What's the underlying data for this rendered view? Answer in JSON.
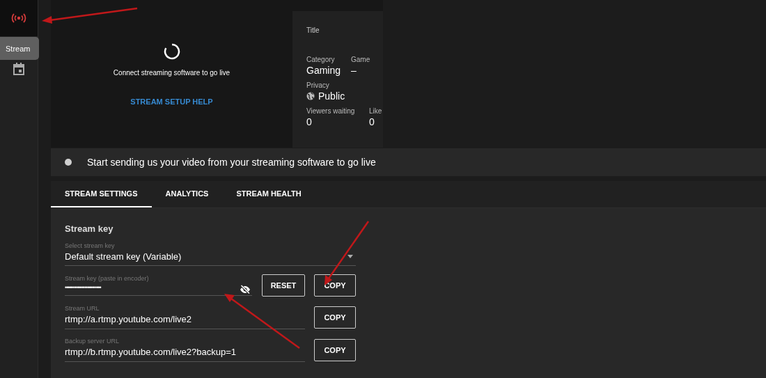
{
  "sidebar": {
    "items": [
      {
        "kind": "stream",
        "selected": true
      },
      {
        "kind": "schedule",
        "selected": false
      }
    ],
    "tooltip": "Stream"
  },
  "preview": {
    "message": "Connect streaming software to go live",
    "help_link": "STREAM SETUP HELP"
  },
  "info": {
    "title_label": "Title",
    "fields": [
      {
        "kind": "plain",
        "label": "Category",
        "value": "Gaming"
      },
      {
        "kind": "plain",
        "label": "Game",
        "value": "–"
      },
      {
        "kind": "privacy",
        "label": "Privacy",
        "value": "Public"
      },
      {
        "kind": "plain",
        "label": "Viewers waiting",
        "value": "0"
      },
      {
        "kind": "plain",
        "label": "Like",
        "value": "0"
      }
    ]
  },
  "status": {
    "text": "Start sending us your video from your streaming software to go live",
    "live": false
  },
  "tabs": [
    {
      "label": "STREAM SETTINGS",
      "selected": true
    },
    {
      "label": "ANALYTICS",
      "selected": false
    },
    {
      "label": "STREAM HEALTH",
      "selected": false
    }
  ],
  "stream_settings": {
    "heading": "Stream key",
    "select": {
      "label": "Select stream key",
      "value": "Default stream key (Variable)"
    },
    "fields": [
      {
        "kind": "secret",
        "label": "Stream key (paste in encoder)",
        "value": "••••••••••••••••••••••••",
        "buttons": [
          "RESET",
          "COPY"
        ]
      },
      {
        "kind": "url",
        "label": "Stream URL",
        "value": "rtmp://a.rtmp.youtube.com/live2",
        "buttons": [
          "COPY"
        ]
      },
      {
        "kind": "url",
        "label": "Backup server URL",
        "value": "rtmp://b.rtmp.youtube.com/live2?backup=1",
        "buttons": [
          "COPY"
        ]
      }
    ]
  }
}
